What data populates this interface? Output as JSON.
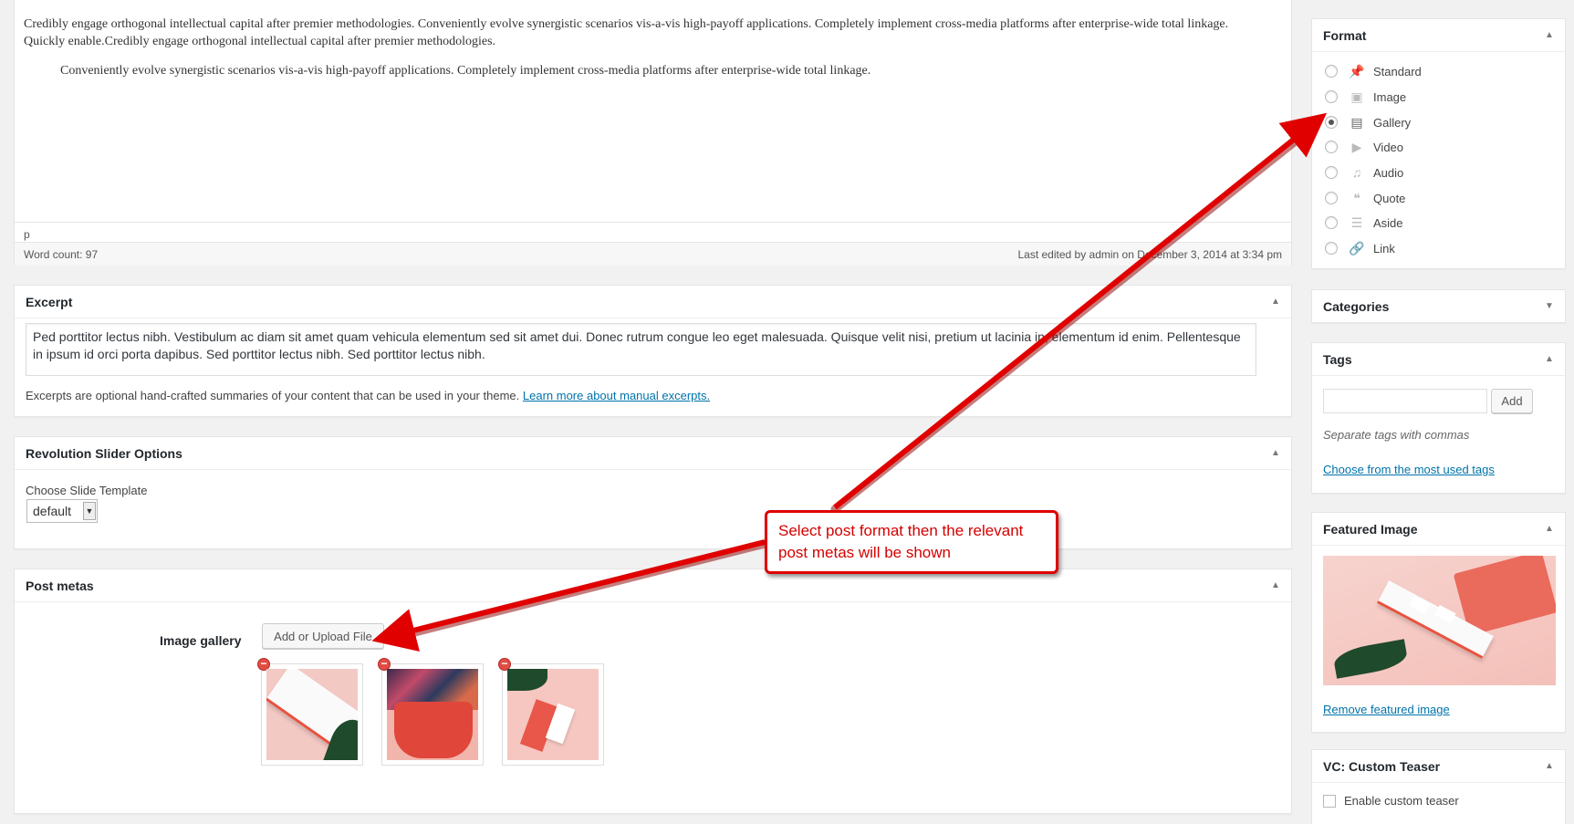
{
  "editor": {
    "paragraph1": "Credibly engage orthogonal intellectual capital after premier methodologies. Conveniently evolve synergistic scenarios vis-a-vis high-payoff applications. Completely implement cross-media platforms after enterprise-wide total linkage. Quickly enable.Credibly engage orthogonal intellectual capital after premier methodologies.",
    "paragraph2": "Conveniently evolve synergistic scenarios vis-a-vis high-payoff applications. Completely implement cross-media platforms after enterprise-wide total linkage.",
    "path": "p",
    "word_count": "Word count: 97",
    "last_edited": "Last edited by admin on December 3, 2014 at 3:34 pm"
  },
  "excerpt": {
    "title": "Excerpt",
    "text": "Ped porttitor lectus nibh. Vestibulum ac diam sit amet quam vehicula elementum sed sit amet dui. Donec rutrum congue leo eget malesuada. Quisque velit nisi, pretium ut lacinia in, elementum id enim. Pellentesque in ipsum id orci porta dapibus. Sed porttitor lectus nibh. Sed porttitor lectus nibh.",
    "help": "Excerpts are optional hand-crafted summaries of your content that can be used in your theme.",
    "help_link": "Learn more about manual excerpts."
  },
  "revslider": {
    "title": "Revolution Slider Options",
    "label": "Choose Slide Template",
    "selected": "default"
  },
  "postmetas": {
    "title": "Post metas",
    "gallery_label": "Image gallery",
    "upload_button": "Add or Upload File"
  },
  "format": {
    "title": "Format",
    "options": [
      {
        "label": "Standard",
        "icon": "pin-icon"
      },
      {
        "label": "Image",
        "icon": "image-icon"
      },
      {
        "label": "Gallery",
        "icon": "gallery-icon"
      },
      {
        "label": "Video",
        "icon": "video-icon"
      },
      {
        "label": "Audio",
        "icon": "audio-icon"
      },
      {
        "label": "Quote",
        "icon": "quote-icon"
      },
      {
        "label": "Aside",
        "icon": "aside-icon"
      },
      {
        "label": "Link",
        "icon": "link-icon"
      }
    ],
    "selected": "Gallery"
  },
  "categories": {
    "title": "Categories"
  },
  "tags": {
    "title": "Tags",
    "add_button": "Add",
    "hint": "Separate tags with commas",
    "most_used_link": "Choose from the most used tags"
  },
  "featured": {
    "title": "Featured Image",
    "remove_link": "Remove featured image"
  },
  "teaser": {
    "title": "VC: Custom Teaser",
    "checkbox_label": "Enable custom teaser"
  },
  "annotation": {
    "text": "Select post format then the relevant post metas will be shown",
    "color": "#e00000"
  }
}
